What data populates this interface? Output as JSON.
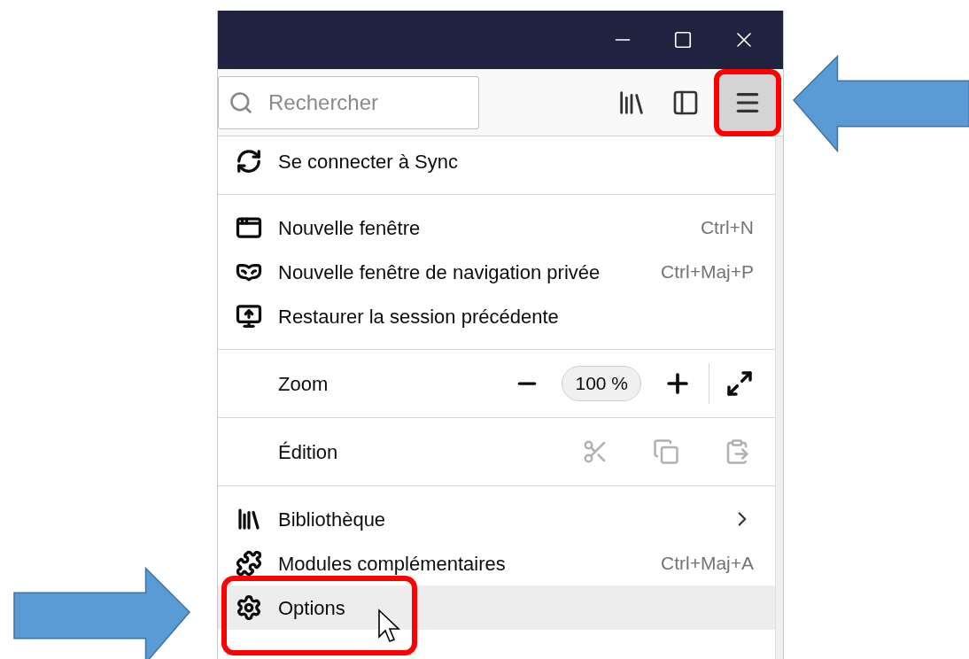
{
  "toolbar": {
    "search": {
      "placeholder": "Rechercher"
    },
    "menu_button": {
      "pressed": true,
      "annotated": true
    }
  },
  "menu": {
    "items": [
      {
        "kind": "sync",
        "label": "Se connecter à Sync",
        "selected": false,
        "submenu": false,
        "annotated": false
      },
      {
        "kind": "divider"
      },
      {
        "kind": "window",
        "label": "Nouvelle fenêtre",
        "shortcut": "Ctrl+N",
        "selected": false,
        "submenu": false,
        "annotated": false
      },
      {
        "kind": "private",
        "label": "Nouvelle fenêtre de navigation privée",
        "shortcut": "Ctrl+Maj+P",
        "selected": false,
        "submenu": false,
        "annotated": false
      },
      {
        "kind": "restore",
        "label": "Restaurer la session précédente",
        "selected": false,
        "submenu": false,
        "annotated": false
      },
      {
        "kind": "divider"
      },
      {
        "kind": "zoom",
        "label": "Zoom",
        "value": "100 %"
      },
      {
        "kind": "divider"
      },
      {
        "kind": "edit",
        "label": "Édition",
        "disabled": true
      },
      {
        "kind": "divider"
      },
      {
        "kind": "library",
        "label": "Bibliothèque",
        "selected": false,
        "submenu": true,
        "annotated": false
      },
      {
        "kind": "addons",
        "label": "Modules complémentaires",
        "shortcut": "Ctrl+Maj+A",
        "selected": false,
        "submenu": false,
        "annotated": false
      },
      {
        "kind": "options",
        "label": "Options",
        "selected": true,
        "submenu": false,
        "annotated": true
      }
    ]
  }
}
